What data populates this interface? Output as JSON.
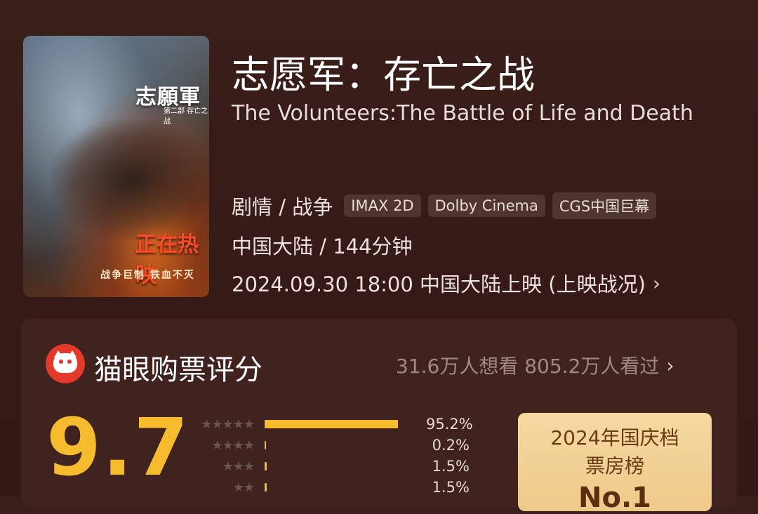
{
  "poster": {
    "title": "志願軍",
    "subtitle": "第二部 存亡之战",
    "showing": "正在热映",
    "slogan": "战争巨制  铁血不灭"
  },
  "movie": {
    "title_cn": "志愿军：存亡之战",
    "title_en": "The Volunteers:The Battle of Life and Death",
    "genre": "剧情 / 战争",
    "tags": [
      "IMAX 2D",
      "Dolby Cinema",
      "CGS中国巨幕"
    ],
    "region_duration": "中国大陆 / 144分钟",
    "release": "2024.09.30 18:00 中国大陆上映 (上映战况)"
  },
  "rating": {
    "title": "猫眼购票评分",
    "stats": "31.6万人想看 805.2万人看过",
    "score": "9.7",
    "distribution": [
      {
        "stars": "★★★★★",
        "fraction": 0.952,
        "percent": "95.2%"
      },
      {
        "stars": "★★★★",
        "fraction": 0.002,
        "percent": "0.2%"
      },
      {
        "stars": "★★★",
        "fraction": 0.015,
        "percent": "1.5%"
      },
      {
        "stars": "★★",
        "fraction": 0.015,
        "percent": "1.5%"
      }
    ]
  },
  "rank": {
    "line1": "2024年国庆档",
    "line2": "票房榜",
    "position": "No.1"
  },
  "colors": {
    "accent": "#f7bb2e",
    "background": "#3a1e1a",
    "logo": "#e43a2a"
  },
  "icons": [
    "maoyan-logo-icon",
    "chevron-right-icon"
  ]
}
